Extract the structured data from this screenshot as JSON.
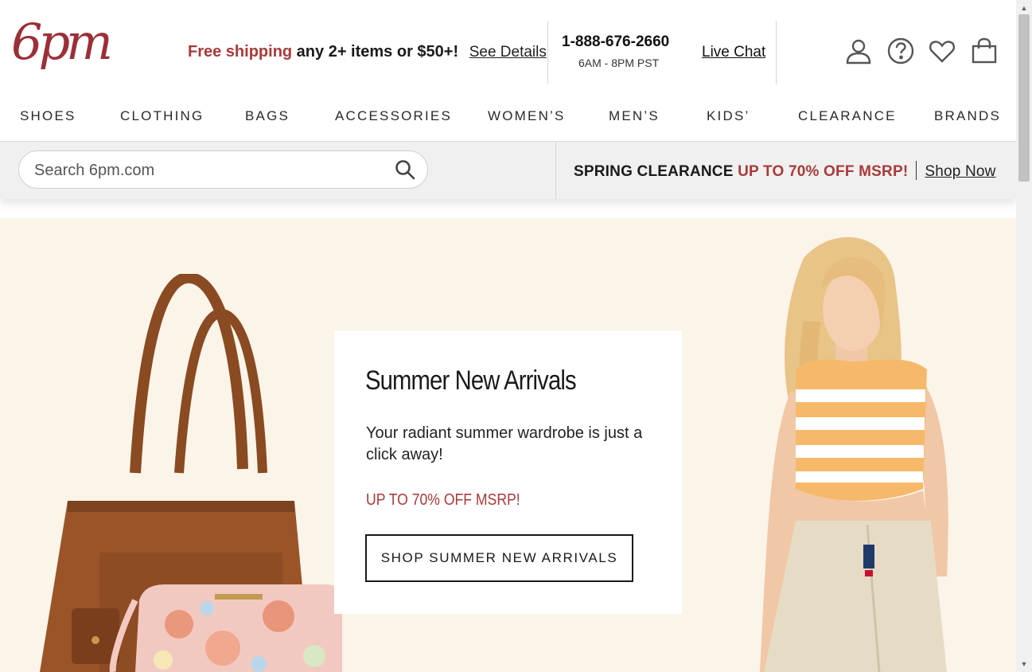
{
  "header": {
    "logo_text": "6pm",
    "promo": {
      "accent": "Free shipping",
      "rest": " any 2+ items or $50+!",
      "details_link": "See Details"
    },
    "contact": {
      "phone": "1-888-676-2660",
      "hours": "6AM - 8PM PST",
      "live_chat": "Live Chat"
    },
    "icons": [
      "account-icon",
      "help-icon",
      "favorites-icon",
      "cart-icon"
    ]
  },
  "nav": {
    "items": [
      "SHOES",
      "CLOTHING",
      "BAGS",
      "ACCESSORIES",
      "WOMEN’S",
      "MEN’S",
      "KIDS’",
      "CLEARANCE",
      "BRANDS"
    ]
  },
  "search": {
    "placeholder": "Search 6pm.com"
  },
  "banner": {
    "title": "SPRING CLEARANCE",
    "accent": "UP TO 70% OFF MSRP!",
    "link": "Shop Now"
  },
  "hero": {
    "title": "Summer New Arrivals",
    "description": "Your radiant summer wardrobe is just a click away!",
    "sale": "UP TO 70% OFF MSRP!",
    "button": "SHOP SUMMER NEW ARRIVALS"
  },
  "colors": {
    "brand": "#9b2f37",
    "accent": "#a83a3a",
    "hero_bg": "#fbf4e8",
    "strip_bg": "#f0f0f0"
  }
}
